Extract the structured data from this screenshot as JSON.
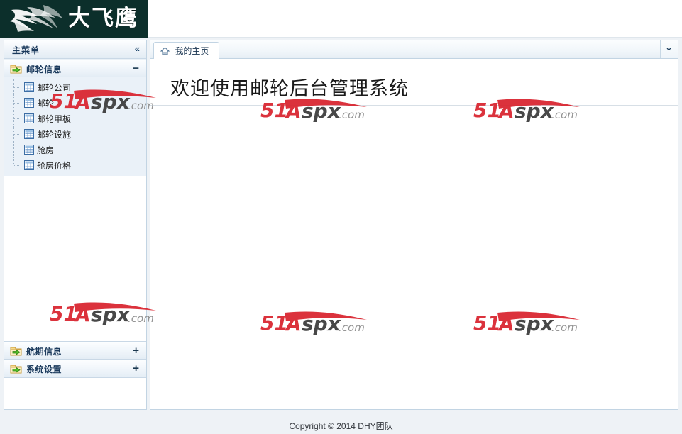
{
  "banner": {
    "logo_text": "大飞鹰",
    "logo_icon": "eagle-logo-icon"
  },
  "sidebar": {
    "title": "主菜单",
    "collapse_icon": "«",
    "groups": [
      {
        "label": "邮轮信息",
        "icon": "folder-arrow-icon",
        "toggle": "−",
        "expanded": true,
        "items": [
          {
            "label": "邮轮公司",
            "icon": "grid-table-icon"
          },
          {
            "label": "邮轮",
            "icon": "grid-table-icon"
          },
          {
            "label": "邮轮甲板",
            "icon": "grid-table-icon"
          },
          {
            "label": "邮轮设施",
            "icon": "grid-table-icon"
          },
          {
            "label": "舱房",
            "icon": "grid-table-icon"
          },
          {
            "label": "舱房价格",
            "icon": "grid-table-icon"
          }
        ]
      },
      {
        "label": "航期信息",
        "icon": "folder-arrow-icon",
        "toggle": "+",
        "expanded": false,
        "items": []
      },
      {
        "label": "系统设置",
        "icon": "folder-arrow-icon",
        "toggle": "+",
        "expanded": false,
        "items": []
      }
    ]
  },
  "main": {
    "tab": {
      "label": "我的主页",
      "icon": "home-icon"
    },
    "tab_tool_icon": "double-chevron-down-icon",
    "welcome_title": "欢迎使用邮轮后台管理系统"
  },
  "watermark": {
    "text_51": "51",
    "text_a": "A",
    "text_spx": "spx",
    "text_com": ".com",
    "color_red": "#d9232e",
    "color_dark": "#3b3b3b",
    "color_gray": "#8b8b8b"
  },
  "footer": {
    "copyright": "Copyright © 2014 DHY团队"
  },
  "colors": {
    "banner_bg": "#0c2f2b",
    "panel_border": "#c2d4e3",
    "title_blue": "#1b3a5c",
    "tree_bg": "#eaf1f8",
    "page_bg": "#eef2f6"
  }
}
